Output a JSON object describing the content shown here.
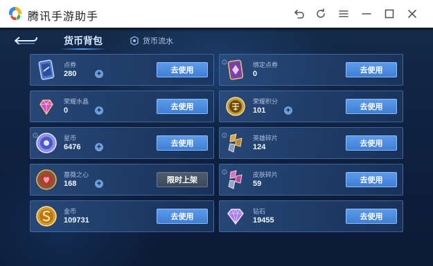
{
  "window": {
    "title": "腾讯手游助手",
    "controls": [
      "back-icon",
      "refresh-icon",
      "menu-icon",
      "minimize-icon",
      "maximize-icon",
      "close-icon"
    ]
  },
  "tabs": {
    "active": "货币背包",
    "secondary": "货币流水"
  },
  "colors": {
    "accent": "#4a8be0",
    "card_border": "#5c86c4",
    "disabled_button": "#4a5768"
  },
  "currencies": [
    {
      "name": "点券",
      "value": "280",
      "button": "去使用",
      "has_plus": true,
      "has_info": false,
      "icon": "coupon-icon"
    },
    {
      "name": "绑定点券",
      "value": "0",
      "button": "去使用",
      "has_plus": false,
      "has_info": true,
      "icon": "bound-coupon-icon"
    },
    {
      "name": "荣耀水晶",
      "value": "0",
      "button": "去使用",
      "has_plus": true,
      "has_info": false,
      "icon": "crystal-icon"
    },
    {
      "name": "荣耀积分",
      "value": "101",
      "button": "去使用",
      "has_plus": true,
      "has_info": false,
      "icon": "points-icon"
    },
    {
      "name": "星币",
      "value": "6476",
      "button": "去使用",
      "has_plus": true,
      "has_info": true,
      "icon": "star-coin-icon"
    },
    {
      "name": "英雄碎片",
      "value": "124",
      "button": "去使用",
      "has_plus": false,
      "has_info": true,
      "icon": "hero-fragment-icon"
    },
    {
      "name": "蔷薇之心",
      "value": "168",
      "button": "限时上架",
      "has_plus": true,
      "has_info": false,
      "icon": "rose-heart-icon"
    },
    {
      "name": "皮肤碎片",
      "value": "59",
      "button": "去使用",
      "has_plus": false,
      "has_info": true,
      "icon": "skin-fragment-icon"
    },
    {
      "name": "金币",
      "value": "109731",
      "button": "去使用",
      "has_plus": false,
      "has_info": false,
      "icon": "gold-coin-icon"
    },
    {
      "name": "钻石",
      "value": "19455",
      "button": "去使用",
      "has_plus": false,
      "has_info": false,
      "icon": "diamond-icon"
    }
  ]
}
